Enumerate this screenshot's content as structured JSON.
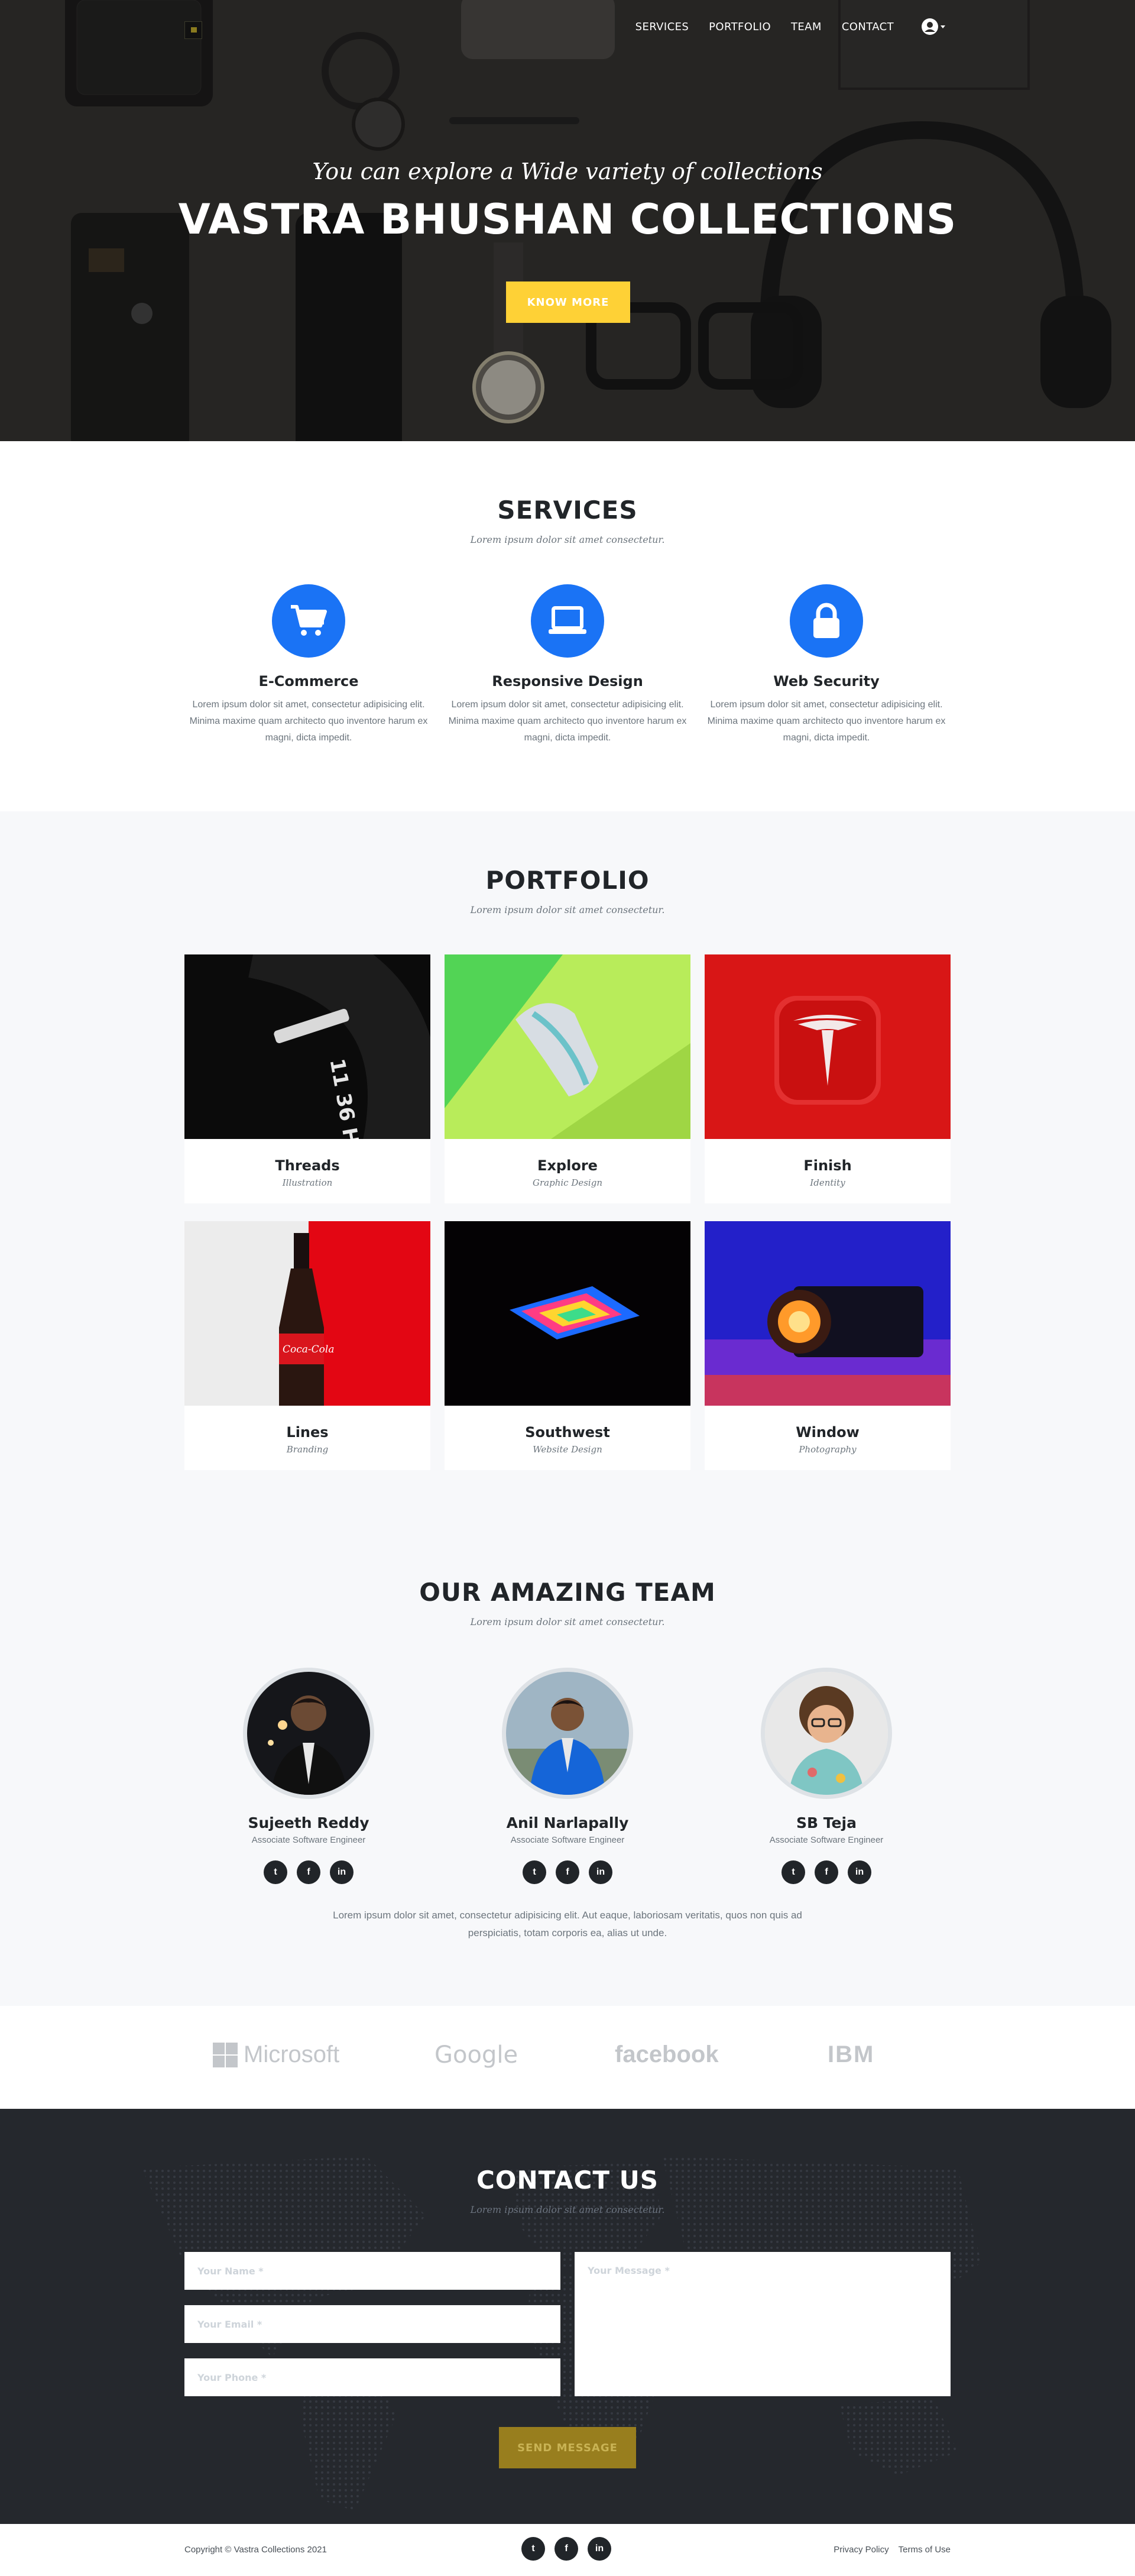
{
  "header": {
    "nav": [
      "SERVICES",
      "PORTFOLIO",
      "TEAM",
      "CONTACT"
    ],
    "user_icon": "user-circle-icon"
  },
  "hero": {
    "subheading": "You can explore a Wide variety of collections",
    "heading": "VASTRA BHUSHAN COLLECTIONS",
    "cta": "KNOW MORE"
  },
  "services": {
    "title": "SERVICES",
    "subtitle": "Lorem ipsum dolor sit amet consectetur.",
    "items": [
      {
        "title": "E-Commerce",
        "icon": "shopping-cart-icon",
        "text": "Lorem ipsum dolor sit amet, consectetur adipisicing elit. Minima maxime quam architecto quo inventore harum ex magni, dicta impedit."
      },
      {
        "title": "Responsive Design",
        "icon": "laptop-icon",
        "text": "Lorem ipsum dolor sit amet, consectetur adipisicing elit. Minima maxime quam architecto quo inventore harum ex magni, dicta impedit."
      },
      {
        "title": "Web Security",
        "icon": "lock-icon",
        "text": "Lorem ipsum dolor sit amet, consectetur adipisicing elit. Minima maxime quam architecto quo inventore harum ex magni, dicta impedit."
      }
    ]
  },
  "portfolio": {
    "title": "PORTFOLIO",
    "subtitle": "Lorem ipsum dolor sit amet consectetur.",
    "items": [
      {
        "title": "Threads",
        "category": "Illustration"
      },
      {
        "title": "Explore",
        "category": "Graphic Design"
      },
      {
        "title": "Finish",
        "category": "Identity"
      },
      {
        "title": "Lines",
        "category": "Branding"
      },
      {
        "title": "Southwest",
        "category": "Website Design"
      },
      {
        "title": "Window",
        "category": "Photography"
      }
    ]
  },
  "team": {
    "title": "OUR AMAZING TEAM",
    "subtitle": "Lorem ipsum dolor sit amet consectetur.",
    "members": [
      {
        "name": "Sujeeth Reddy",
        "role": "Associate Software Engineer"
      },
      {
        "name": "Anil Narlapally",
        "role": "Associate Software Engineer"
      },
      {
        "name": "SB Teja",
        "role": "Associate Software Engineer"
      }
    ],
    "note": "Lorem ipsum dolor sit amet, consectetur adipisicing elit. Aut eaque, laboriosam veritatis, quos non quis ad perspiciatis, totam corporis ea, alias ut unde."
  },
  "clients": [
    "Microsoft",
    "Google",
    "facebook",
    "IBM"
  ],
  "contact": {
    "title": "CONTACT US",
    "subtitle": "Lorem ipsum dolor sit amet consectetur.",
    "name_placeholder": "Your Name *",
    "email_placeholder": "Your Email *",
    "phone_placeholder": "Your Phone *",
    "message_placeholder": "Your Message *",
    "submit": "SEND MESSAGE"
  },
  "footer": {
    "copyright": "Copyright © Vastra Collections 2021",
    "privacy": "Privacy Policy",
    "terms": "Terms of Use"
  },
  "colors": {
    "accent": "#fed136",
    "primary": "#1a73f5",
    "dark": "#25282d"
  }
}
